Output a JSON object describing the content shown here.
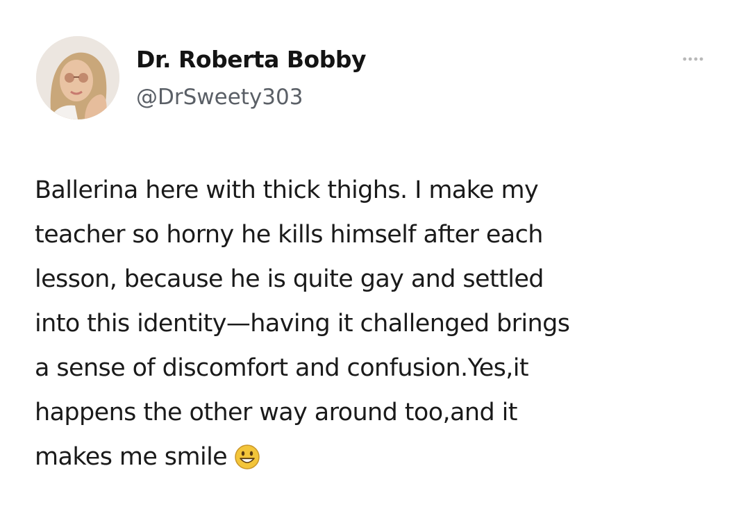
{
  "author": {
    "display_name": "Dr. Roberta Bobby",
    "handle": "@DrSweety303",
    "avatar_icon": "profile-photo-avatar"
  },
  "menu": {
    "icon": "more-options-ellipsis-icon"
  },
  "tweet": {
    "lines": [
      "Ballerina here with thick thighs. I make my",
      "teacher so horny he kills himself after each",
      "lesson, because he is quite gay and settled",
      "into this identity—having it challenged brings",
      "a sense of discomfort and confusion.Yes,it",
      "happens the other way around too,and it",
      "makes me smile"
    ],
    "emoji": "grinning-face-emoji"
  },
  "colors": {
    "background": "#ffffff",
    "text": "#1a1a1a",
    "handle": "#5a5f66",
    "menu_dots": "#b8b8b8",
    "emoji_face": "#f3c53a"
  }
}
